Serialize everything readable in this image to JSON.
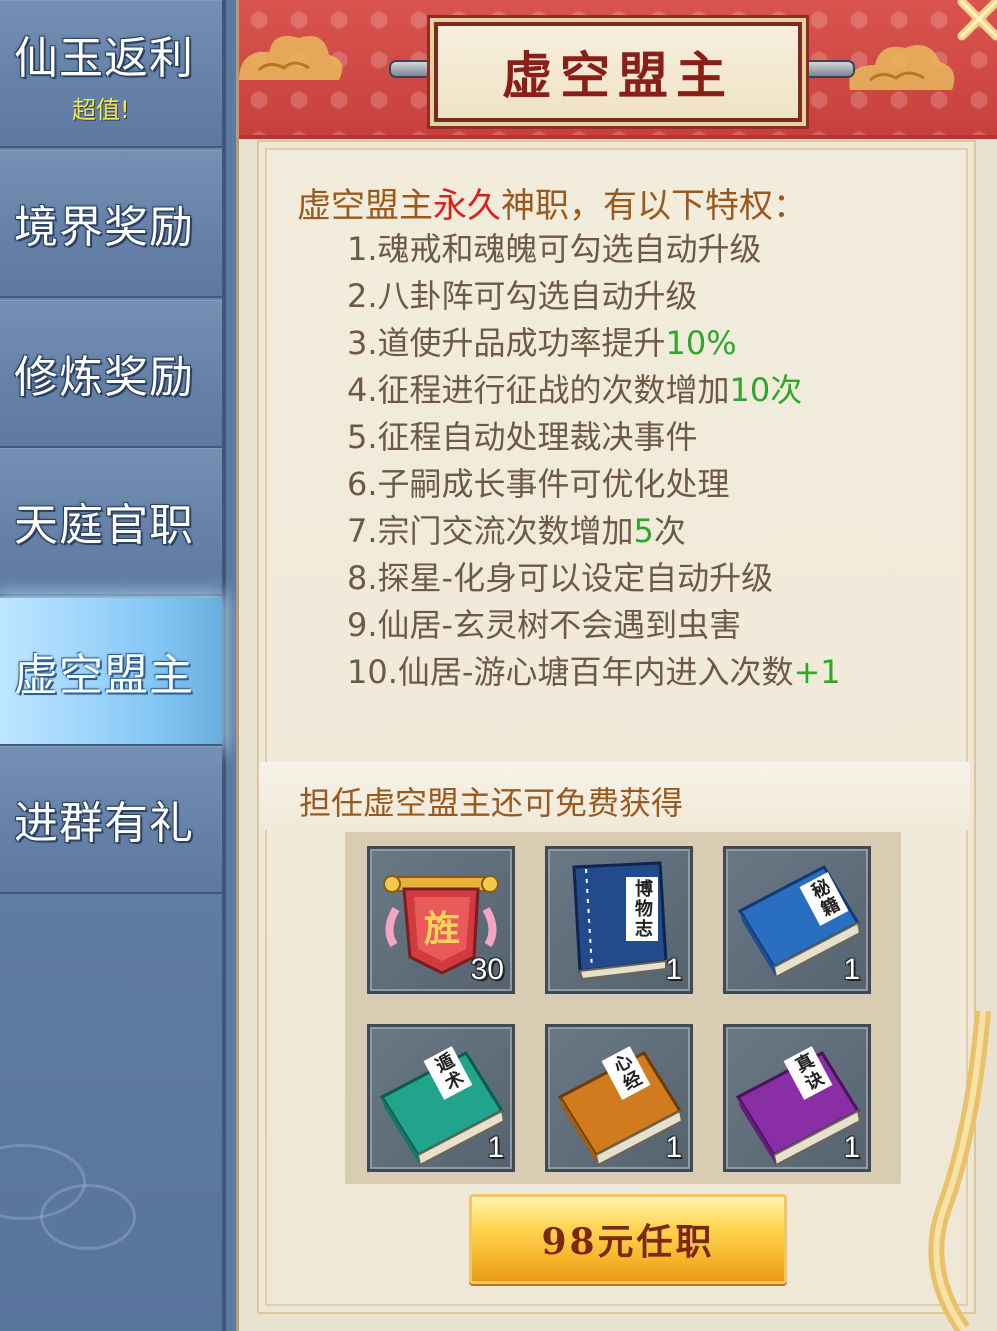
{
  "sidebar": {
    "items": [
      {
        "label": "仙玉返利",
        "sub": "超值!"
      },
      {
        "label": "境界奖励"
      },
      {
        "label": "修炼奖励"
      },
      {
        "label": "天庭官职"
      },
      {
        "label": "虚空盟主",
        "active": true
      },
      {
        "label": "进群有礼"
      }
    ]
  },
  "panel": {
    "title": "虚空盟主",
    "privilege_intro": {
      "part1": "虚空盟主",
      "part2": "永久",
      "part3": "神职，有以下特权："
    },
    "privileges": [
      {
        "text": "1.魂戒和魂魄可勾选自动升级",
        "highlight": ""
      },
      {
        "text": "2.八卦阵可勾选自动升级",
        "highlight": ""
      },
      {
        "text": "3.道使升品成功率提升",
        "highlight": "10%"
      },
      {
        "text": "4.征程进行征战的次数增加",
        "highlight": "10次"
      },
      {
        "text": "5.征程自动处理裁决事件",
        "highlight": ""
      },
      {
        "text": "6.子嗣成长事件可优化处理",
        "highlight": ""
      },
      {
        "text": "7.宗门交流次数增加",
        "highlight": "5",
        "suffix": "次"
      },
      {
        "text": "8.探星-化身可以设定自动升级",
        "highlight": ""
      },
      {
        "text": "9.仙居-玄灵树不会遇到虫害",
        "highlight": ""
      },
      {
        "text": "10.仙居-游心塘百年内进入次数",
        "highlight": "+1"
      }
    ],
    "free_title": "担任虚空盟主还可免费获得",
    "rewards": [
      {
        "icon": "red-banner-icon",
        "count": "30",
        "book_text": ""
      },
      {
        "icon": "blue-book-icon",
        "count": "1",
        "book_text": "博物志"
      },
      {
        "icon": "blue-book-icon",
        "count": "1",
        "book_text": "秘籍"
      },
      {
        "icon": "teal-book-icon",
        "count": "1",
        "book_text": "遁术"
      },
      {
        "icon": "orange-book-icon",
        "count": "1",
        "book_text": "心经"
      },
      {
        "icon": "purple-book-icon",
        "count": "1",
        "book_text": "真诀"
      }
    ],
    "buy_button": "98元任职"
  },
  "colors": {
    "sidebar_bg": "#6682a8",
    "sidebar_active": "#9ed5fb",
    "header_red": "#c9403d",
    "title_text": "#8a1f1a",
    "body_text": "#6e5a44",
    "gold_text": "#9a5a1e",
    "highlight_green": "#2da82a",
    "highlight_red": "#d8231d",
    "button_gold": "#f6b42a"
  }
}
